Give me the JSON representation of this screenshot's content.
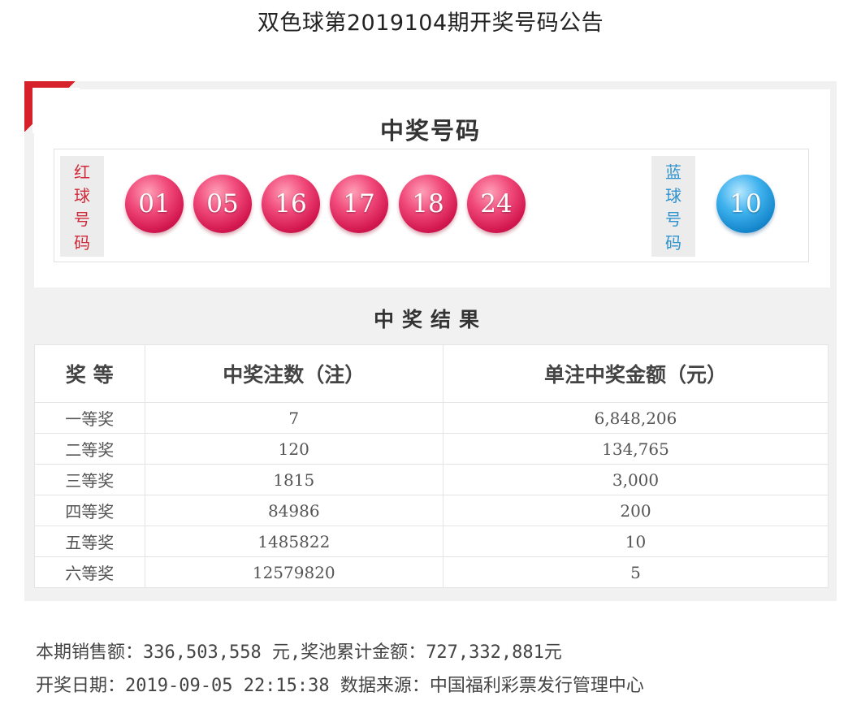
{
  "page": {
    "title": "双色球第2019104期开奖号码公告"
  },
  "winning": {
    "title": "中奖号码",
    "red_label": [
      "红",
      "球",
      "号",
      "码"
    ],
    "blue_label": [
      "蓝",
      "球",
      "号",
      "码"
    ],
    "red_balls": [
      "01",
      "05",
      "16",
      "17",
      "18",
      "24"
    ],
    "blue_ball": "10",
    "colors": {
      "red": "#d2174f",
      "blue": "#1688cd",
      "accent": "#d6202a"
    }
  },
  "results": {
    "title": "中奖结果",
    "headers": [
      "奖 等",
      "中奖注数（注）",
      "单注中奖金额（元）"
    ],
    "rows": [
      {
        "level": "一等奖",
        "count": "7",
        "amount": "6,848,206"
      },
      {
        "level": "二等奖",
        "count": "120",
        "amount": "134,765"
      },
      {
        "level": "三等奖",
        "count": "1815",
        "amount": "3,000"
      },
      {
        "level": "四等奖",
        "count": "84986",
        "amount": "200"
      },
      {
        "level": "五等奖",
        "count": "1485822",
        "amount": "10"
      },
      {
        "level": "六等奖",
        "count": "12579820",
        "amount": "5"
      }
    ]
  },
  "footer": {
    "sales_line": "本期销售额：336,503,558 元,奖池累计金额：727,332,881元",
    "date_line": "开奖日期：2019-09-05 22:15:38 数据来源：中国福利彩票发行管理中心"
  }
}
